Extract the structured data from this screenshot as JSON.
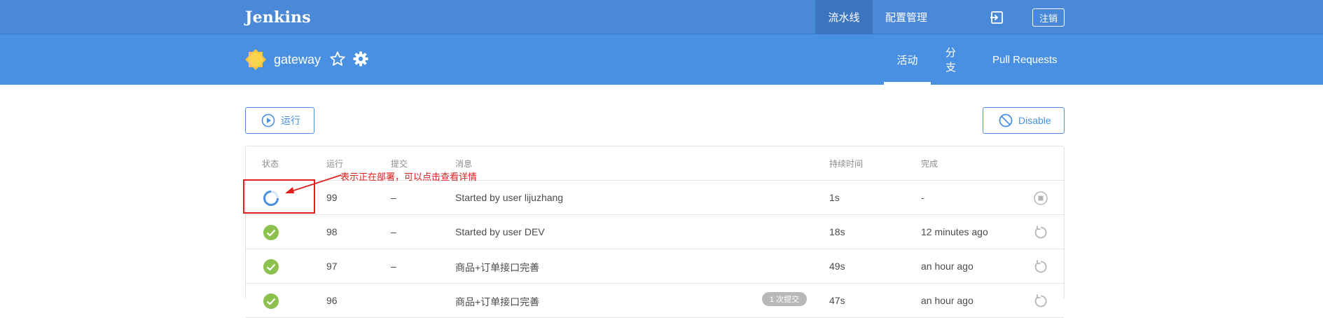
{
  "app": {
    "brand": "Jenkins",
    "nav_pipelines": "流水线",
    "nav_admin": "配置管理",
    "logout": "注销"
  },
  "pipeline": {
    "name": "gateway",
    "tabs": [
      "活动",
      "分支",
      "Pull Requests"
    ]
  },
  "actions": {
    "run": "运行",
    "disable": "Disable"
  },
  "table": {
    "columns": [
      "状态",
      "运行",
      "提交",
      "消息",
      "持续时间",
      "完成"
    ],
    "rows": [
      {
        "status": "running",
        "run": "99",
        "commit": "–",
        "message": "Started by user lijuzhang",
        "duration": "1s",
        "completed": "-",
        "badge": ""
      },
      {
        "status": "success",
        "run": "98",
        "commit": "–",
        "message": "Started by user DEV",
        "duration": "18s",
        "completed": "12 minutes ago",
        "badge": ""
      },
      {
        "status": "success",
        "run": "97",
        "commit": "–",
        "message": "商品+订单接口完善",
        "duration": "49s",
        "completed": "an hour ago",
        "badge": ""
      },
      {
        "status": "success",
        "run": "96",
        "commit": "",
        "message": "商品+订单接口完善",
        "duration": "47s",
        "completed": "an hour ago",
        "badge": "1 次提交"
      }
    ]
  },
  "annotation": {
    "text": "表示正在部署，可以点击查看详情",
    "color": "#e02020"
  },
  "colors": {
    "nav": "#4a88d8",
    "header": "#4a90e2",
    "success": "#8cc04f",
    "running": "#4a90e2"
  }
}
